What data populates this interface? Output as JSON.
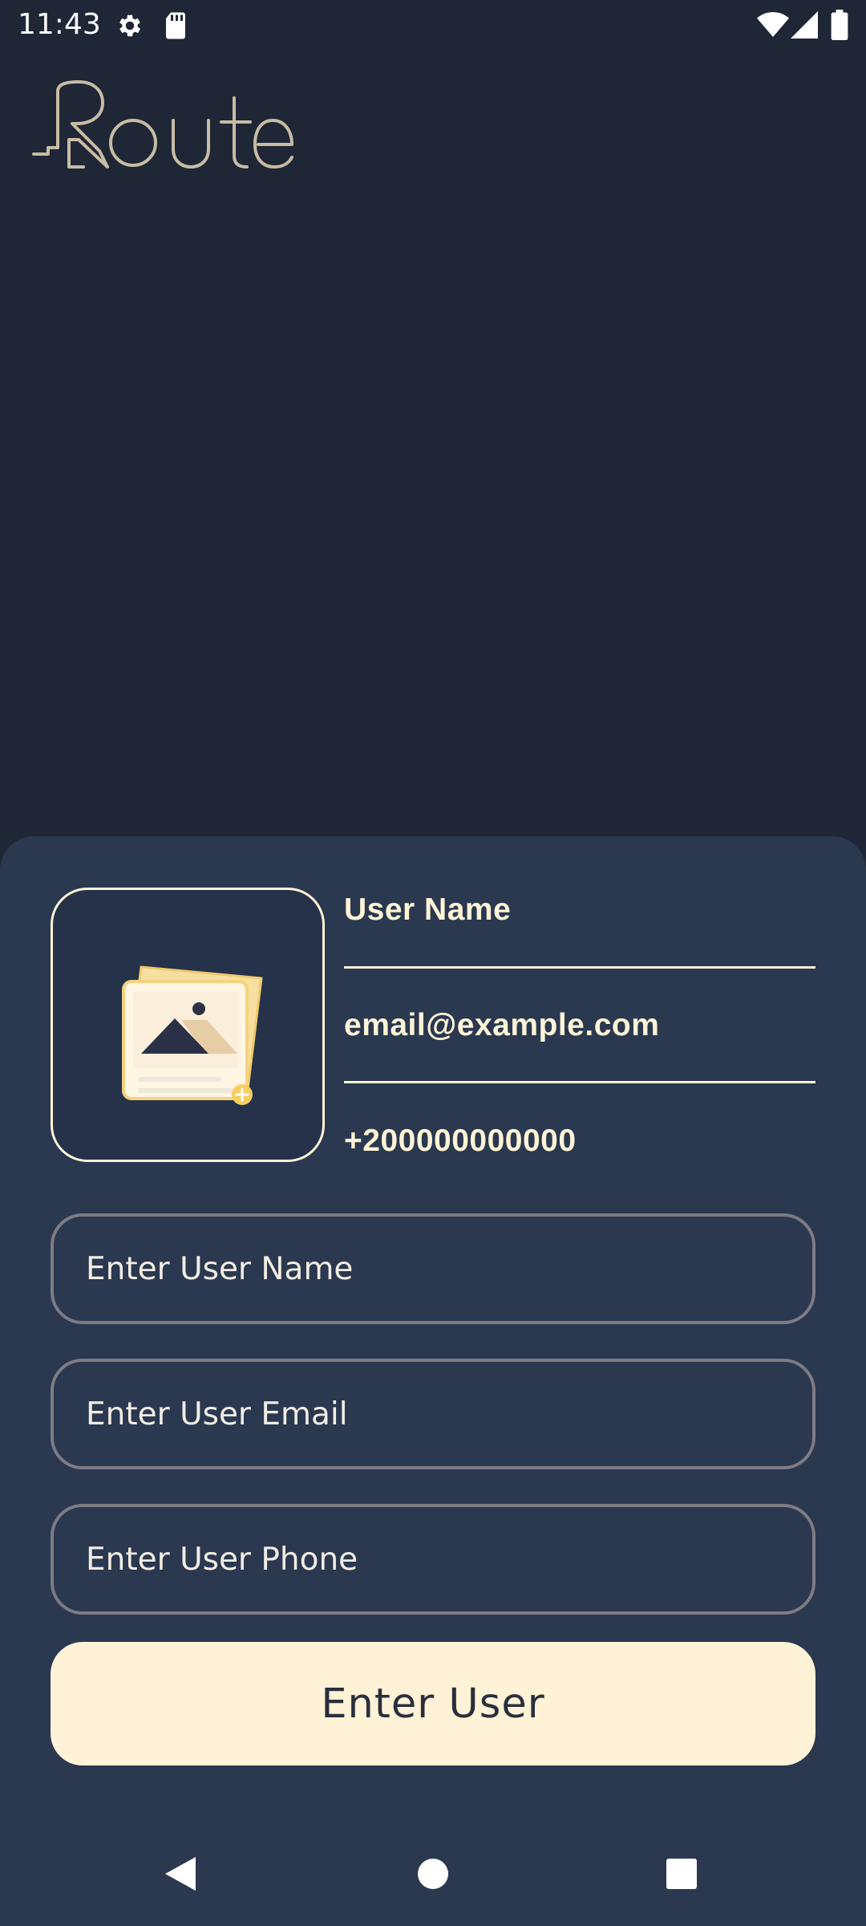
{
  "status_bar": {
    "time": "11:43",
    "icons": [
      "settings-icon",
      "sd-card-icon",
      "wifi-icon",
      "signal-icon",
      "battery-icon"
    ]
  },
  "app": {
    "logo_text": "Route"
  },
  "user_info": {
    "name": "User Name",
    "email": "email@example.com",
    "phone": "+200000000000"
  },
  "form": {
    "name_placeholder": "Enter User Name",
    "email_placeholder": "Enter User Email",
    "phone_placeholder": "Enter User Phone",
    "submit_label": "Enter User"
  },
  "nav_bar": {
    "icons": [
      "back-icon",
      "home-icon",
      "recents-icon"
    ]
  },
  "colors": {
    "background": "#1F2635",
    "sheet": "#2A3850",
    "accent": "#FFF4D6",
    "button": "#FFF2D6",
    "field_border": "#7D7C85"
  }
}
